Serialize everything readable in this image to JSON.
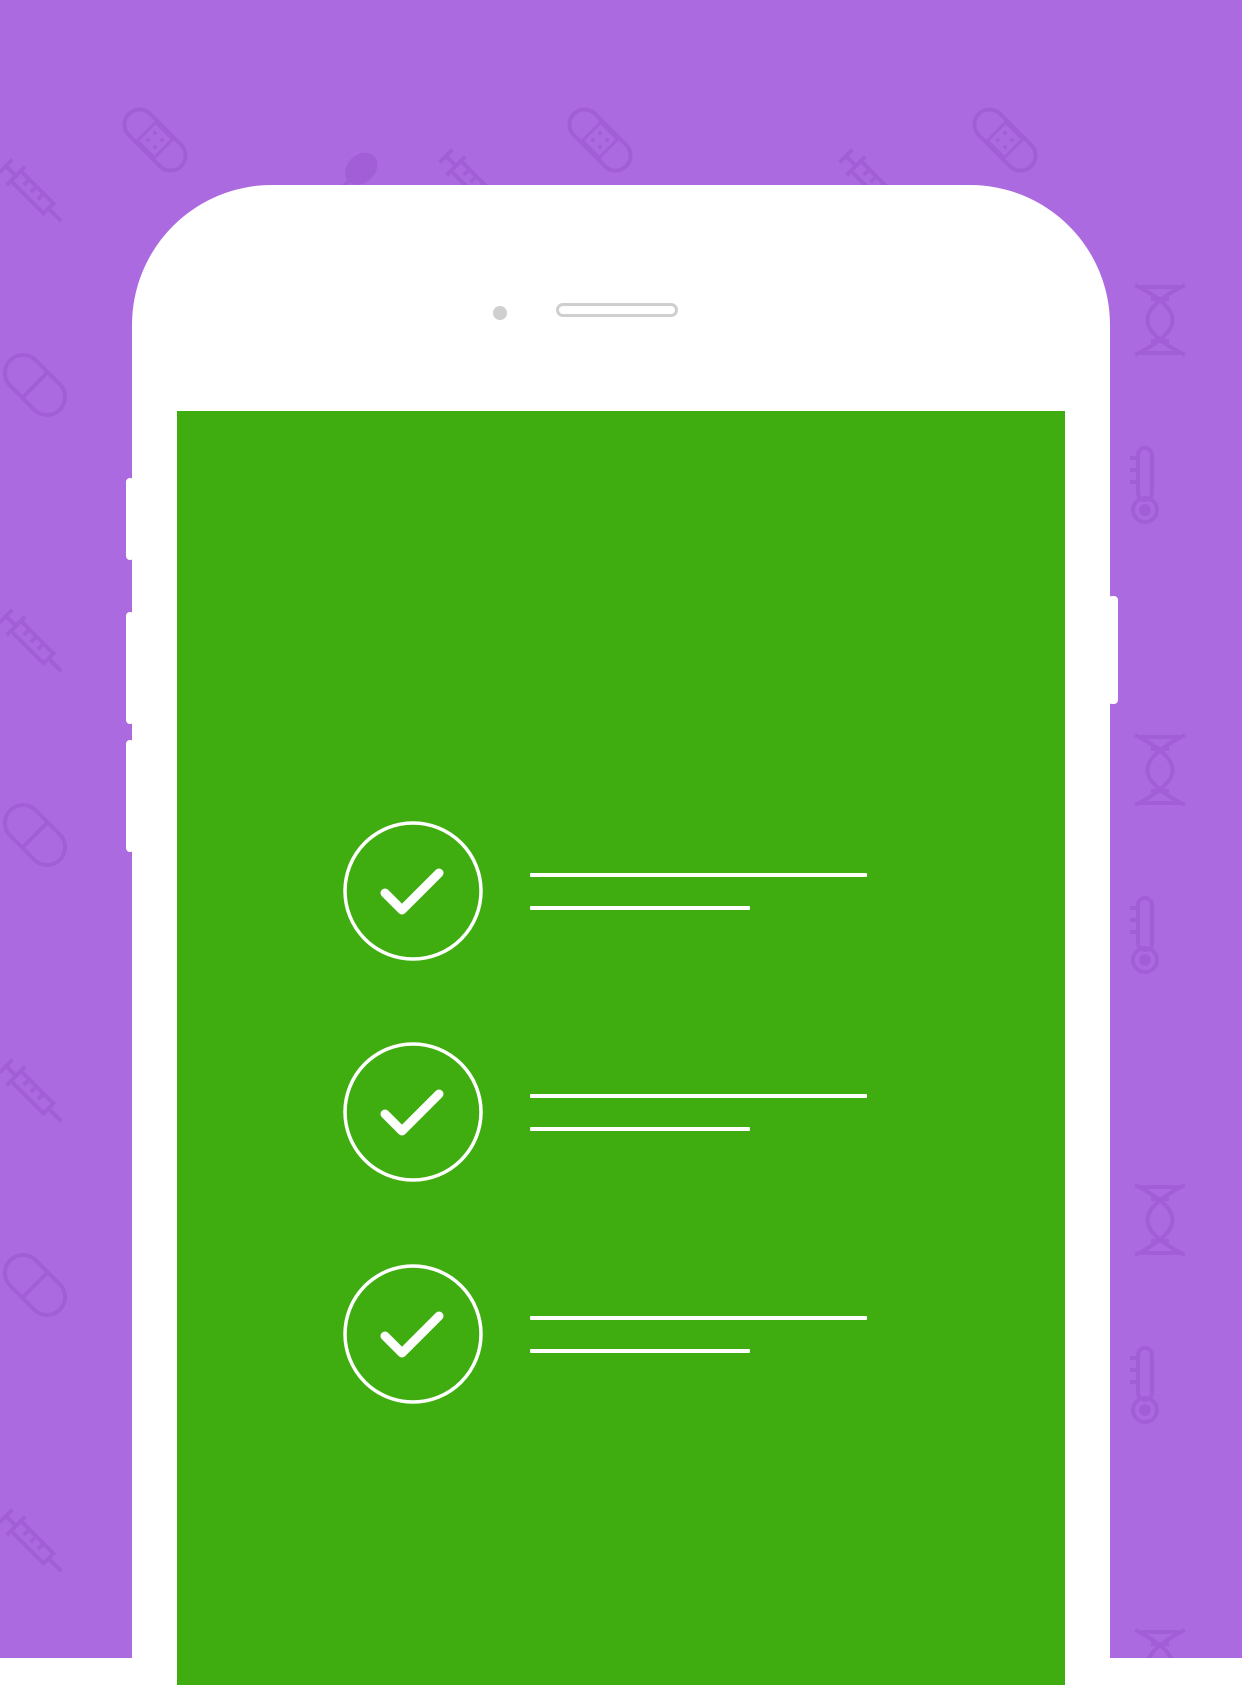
{
  "colors": {
    "background": "#ac6ae0",
    "pattern": "#9a55d0",
    "phone_body": "#ffffff",
    "screen": "#3fad10",
    "check": "#ffffff",
    "camera": "#cfcfcf"
  },
  "background": {
    "pattern_icons": [
      "bandage-icon",
      "syringe-icon",
      "pill-icon",
      "dna-icon",
      "thermometer-icon",
      "spoon-icon"
    ]
  },
  "checklist": {
    "items": [
      {
        "icon": "check-circle-icon",
        "checked": true
      },
      {
        "icon": "check-circle-icon",
        "checked": true
      },
      {
        "icon": "check-circle-icon",
        "checked": true
      }
    ]
  }
}
